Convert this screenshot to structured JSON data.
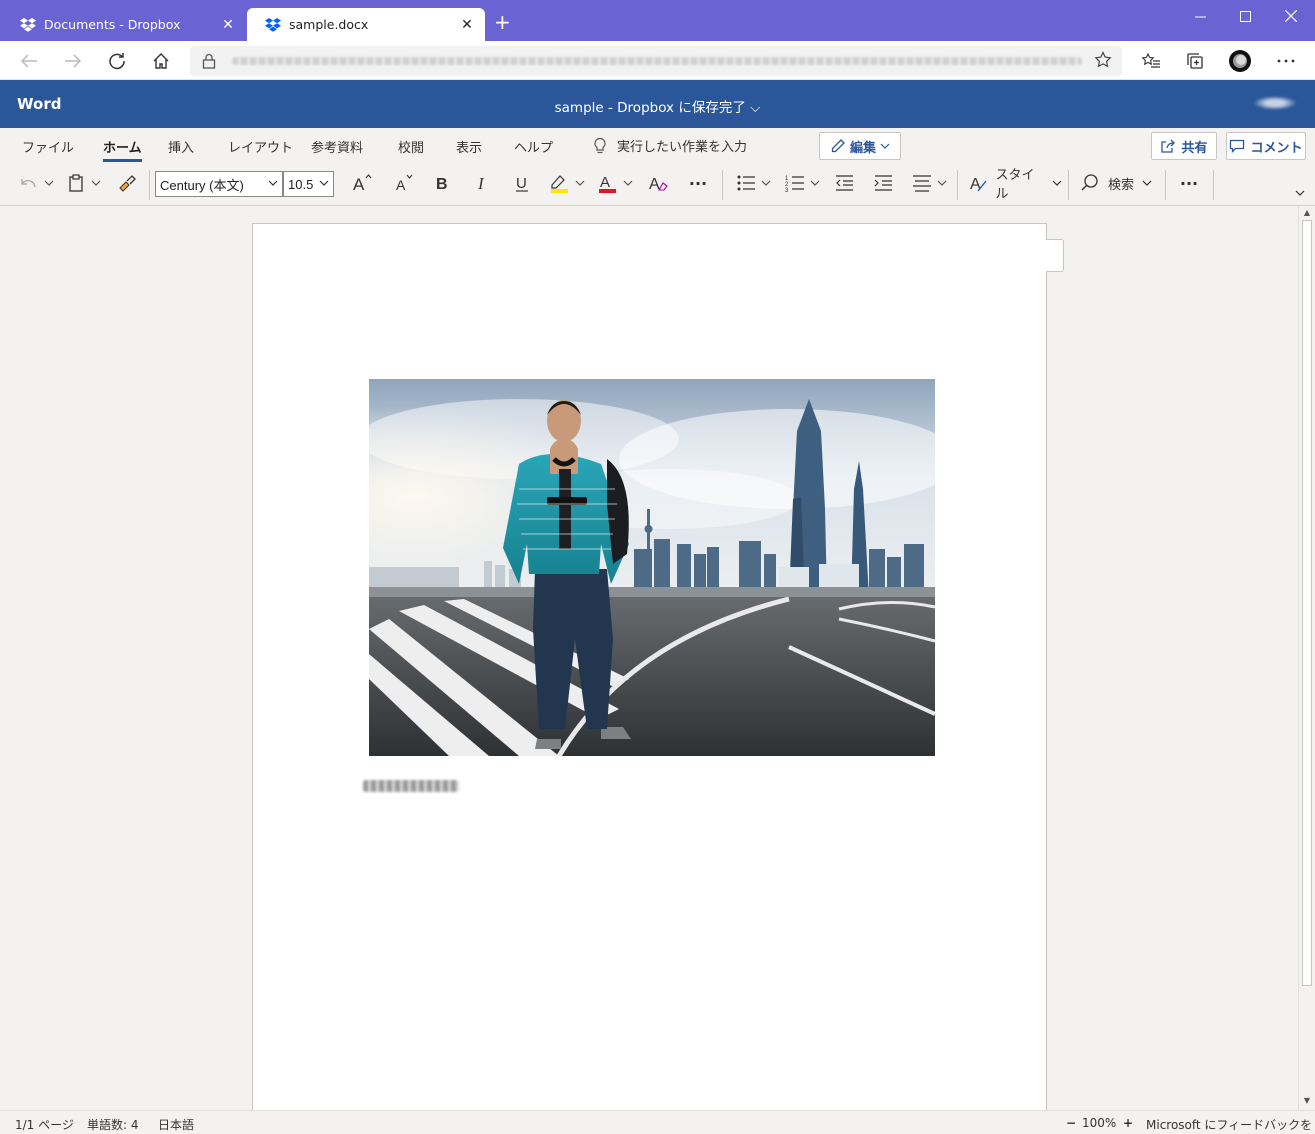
{
  "browser": {
    "tabs": [
      {
        "title": "Documents - Dropbox",
        "icon": "dropbox-icon",
        "active": false
      },
      {
        "title": "sample.docx",
        "icon": "dropbox-icon",
        "active": true
      }
    ],
    "new_tab": "+",
    "window_controls": {
      "minimize": "─",
      "maximize": "☐",
      "close": "✕"
    },
    "address_bar": {
      "url": ""
    }
  },
  "word": {
    "brand": "Word",
    "doc_title": "sample - Dropbox に保存完了 ⌵",
    "menu_tabs": [
      "ファイル",
      "ホーム",
      "挿入",
      "レイアウト",
      "参考資料",
      "校閲",
      "表示",
      "ヘルプ"
    ],
    "active_tab": "ホーム",
    "tell_me": "実行したい作業を入力",
    "edit_button": "編集",
    "share_button": "共有",
    "comment_button": "コメント",
    "font_name": "Century (本文)",
    "font_size": "10.5",
    "style_label": "スタイル",
    "find_label": "検索",
    "more": "···",
    "highlight_color": "#ffe600",
    "font_color": "#e81123",
    "accent": "#2b579a"
  },
  "status": {
    "page": "1/1 ページ",
    "words": "単語数: 4",
    "language": "日本語",
    "zoom_out": "−",
    "zoom": "100%",
    "zoom_in": "+",
    "feedback": "Microsoft にフィードバックを送信"
  }
}
